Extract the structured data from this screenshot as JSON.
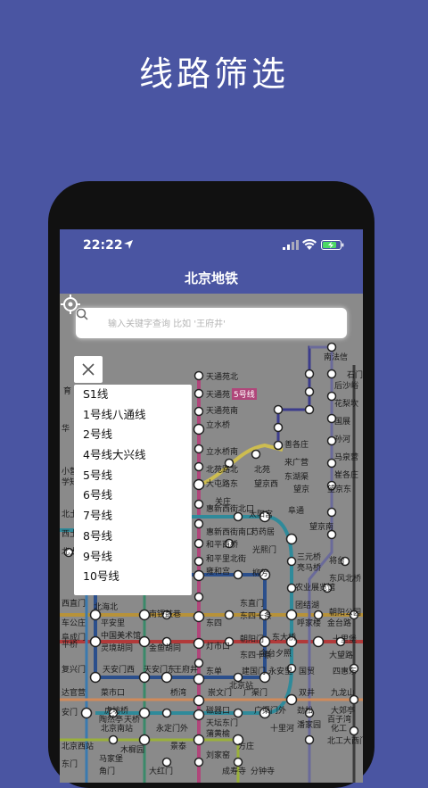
{
  "promo": {
    "title": "线路筛选"
  },
  "status_bar": {
    "time": "22:22"
  },
  "nav": {
    "title": "北京地铁"
  },
  "search": {
    "placeholder": "输入关键字查询 比如 '王府井'",
    "value": ""
  },
  "line_filter": {
    "items": [
      "S1线",
      "1号线八通线",
      "2号线",
      "4号线大兴线",
      "5号线",
      "6号线",
      "7号线",
      "8号线",
      "9号线",
      "10号线"
    ]
  },
  "map_labels": [
    {
      "text": "南法信"
    },
    {
      "text": "石门"
    },
    {
      "text": "后沙峪"
    },
    {
      "text": "天通苑北"
    },
    {
      "text": "天通苑"
    },
    {
      "text": "5号线"
    },
    {
      "text": "天通苑南"
    },
    {
      "text": "花梨坎"
    },
    {
      "text": "立水桥"
    },
    {
      "text": "国展"
    },
    {
      "text": "孙河"
    },
    {
      "text": "马泉营"
    },
    {
      "text": "善各庄"
    },
    {
      "text": "立水桥南"
    },
    {
      "text": "来广营"
    },
    {
      "text": "崔各庄"
    },
    {
      "text": "北苑路北"
    },
    {
      "text": "北苑"
    },
    {
      "text": "东湖渠"
    },
    {
      "text": "大屯路东"
    },
    {
      "text": "望京西"
    },
    {
      "text": "望京"
    },
    {
      "text": "望京东"
    },
    {
      "text": "关庄"
    },
    {
      "text": "惠新西街北口"
    },
    {
      "text": "太阳宫"
    },
    {
      "text": "阜通"
    },
    {
      "text": "望京南"
    },
    {
      "text": "惠新西街南口"
    },
    {
      "text": "芍药居"
    },
    {
      "text": "和平西桥"
    },
    {
      "text": "光熙门"
    },
    {
      "text": "三元桥"
    },
    {
      "text": "亮马桥"
    },
    {
      "text": "将台"
    },
    {
      "text": "和平里北街"
    },
    {
      "text": "雍和宫"
    },
    {
      "text": "柳芳"
    },
    {
      "text": "东风北桥"
    },
    {
      "text": "农业展览馆"
    },
    {
      "text": "团结湖"
    },
    {
      "text": "东直门"
    },
    {
      "text": "东四十条"
    },
    {
      "text": "呼家楼"
    },
    {
      "text": "金台路"
    },
    {
      "text": "朝阳公园"
    },
    {
      "text": "东大桥"
    },
    {
      "text": "十里堡"
    },
    {
      "text": "北海北"
    },
    {
      "text": "南锣鼓巷"
    },
    {
      "text": "东四"
    },
    {
      "text": "朝阳门"
    },
    {
      "text": "平安里"
    },
    {
      "text": "中国美术馆"
    },
    {
      "text": "灵境胡同"
    },
    {
      "text": "金鱼胡同"
    },
    {
      "text": "灯市口"
    },
    {
      "text": "东四十条"
    },
    {
      "text": "金台夕照"
    },
    {
      "text": "大望路"
    },
    {
      "text": "天安门西"
    },
    {
      "text": "天安门东"
    },
    {
      "text": "王府井"
    },
    {
      "text": "东单"
    },
    {
      "text": "建国门"
    },
    {
      "text": "永安里"
    },
    {
      "text": "国贸"
    },
    {
      "text": "四惠东"
    },
    {
      "text": "北京站"
    },
    {
      "text": "菜市口"
    },
    {
      "text": "桥湾"
    },
    {
      "text": "崇文门"
    },
    {
      "text": "广渠门"
    },
    {
      "text": "双井"
    },
    {
      "text": "九龙山"
    },
    {
      "text": "虎坊桥"
    },
    {
      "text": "磁器口"
    },
    {
      "text": "广渠门外"
    },
    {
      "text": "劲松"
    },
    {
      "text": "大郊亭"
    },
    {
      "text": "陶然亭"
    },
    {
      "text": "天桥"
    },
    {
      "text": "天坛东门"
    },
    {
      "text": "百子湾"
    },
    {
      "text": "北京南站"
    },
    {
      "text": "永定门外"
    },
    {
      "text": "蒲黄榆"
    },
    {
      "text": "十里河"
    },
    {
      "text": "潘家园"
    },
    {
      "text": "化工"
    },
    {
      "text": "景泰"
    },
    {
      "text": "方庄"
    },
    {
      "text": "北工大西门"
    },
    {
      "text": "木樨园"
    },
    {
      "text": "刘家窑"
    },
    {
      "text": "马家堡"
    },
    {
      "text": "角门"
    },
    {
      "text": "大红门"
    },
    {
      "text": "成寿寺"
    },
    {
      "text": "分钟寺"
    },
    {
      "text": "西直门"
    },
    {
      "text": "车公庄"
    },
    {
      "text": "平桥"
    },
    {
      "text": "阜成门"
    },
    {
      "text": "复兴门"
    },
    {
      "text": "达官营"
    },
    {
      "text": "安门"
    },
    {
      "text": "北京西站"
    },
    {
      "text": "东门"
    },
    {
      "text": "小营"
    },
    {
      "text": "学知"
    },
    {
      "text": "北土"
    },
    {
      "text": "北太"
    },
    {
      "text": "西土"
    },
    {
      "text": "华"
    },
    {
      "text": "育"
    }
  ],
  "colors": {
    "brand": "#4a55a2",
    "map_bg": "#8a8a8a",
    "line5": "#b0467a",
    "line10": "#2f8a9a",
    "line2": "#2b4f8c",
    "line1": "#b23a3a",
    "line6": "#b7923a",
    "line13": "#cdbd50"
  }
}
